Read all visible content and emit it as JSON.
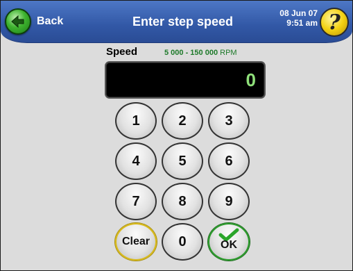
{
  "header": {
    "back_label": "Back",
    "title": "Enter step speed",
    "date": "08 Jun 07",
    "time": "9:51 am",
    "help_symbol": "?"
  },
  "speed": {
    "label": "Speed",
    "range": "5 000 - 150 000",
    "unit": "RPM",
    "value": "0"
  },
  "keypad": {
    "k1": "1",
    "k2": "2",
    "k3": "3",
    "k4": "4",
    "k5": "5",
    "k6": "6",
    "k7": "7",
    "k8": "8",
    "k9": "9",
    "clear": "Clear",
    "k0": "0",
    "ok": "OK"
  },
  "colors": {
    "header": "#3258a6",
    "display_text": "#8fe07a",
    "range_text": "#1e7a2a",
    "ok_accent": "#2a9a2a",
    "clear_accent": "#d8b91a"
  },
  "icons": {
    "back": "left-arrow-icon",
    "help": "question-mark-icon",
    "ok": "checkmark-icon"
  }
}
